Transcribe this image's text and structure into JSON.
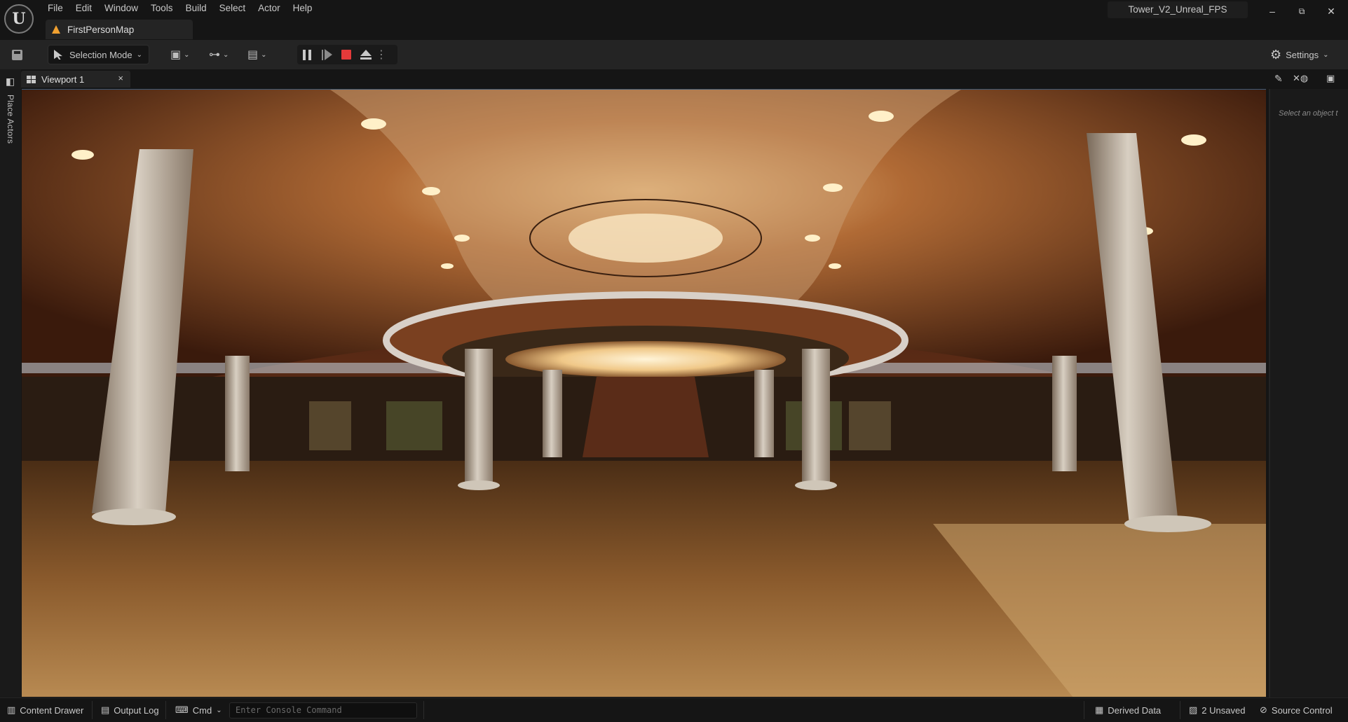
{
  "app": {
    "logo": "U",
    "menu": [
      "File",
      "Edit",
      "Window",
      "Tools",
      "Build",
      "Select",
      "Actor",
      "Help"
    ],
    "map_tab": "FirstPersonMap",
    "project_name": "Tower_V2_Unreal_FPS",
    "window_controls": {
      "minimize": "–",
      "restore": "⧉",
      "close": "✕"
    }
  },
  "toolbar": {
    "selection_mode": "Selection Mode",
    "settings": "Settings",
    "chevron": "⌄"
  },
  "left_rail": {
    "label": "Place Actors"
  },
  "viewport": {
    "tab_label": "Viewport 1",
    "close": "×"
  },
  "details": {
    "hint": "Select an object t"
  },
  "statusbar": {
    "content_drawer": "Content Drawer",
    "output_log": "Output Log",
    "cmd": "Cmd",
    "console_placeholder": "Enter Console Command",
    "derived_data": "Derived Data",
    "unsaved": "2 Unsaved",
    "source_control": "Source Control"
  },
  "icons": {
    "save": "save-icon",
    "place": "place-actors-icon",
    "gear": "⚙",
    "cmd": "⌨"
  },
  "colors": {
    "stop": "#e53a3a",
    "map_icon": "#f0a030",
    "panel_bg": "#242424",
    "window_bg": "#151515"
  }
}
